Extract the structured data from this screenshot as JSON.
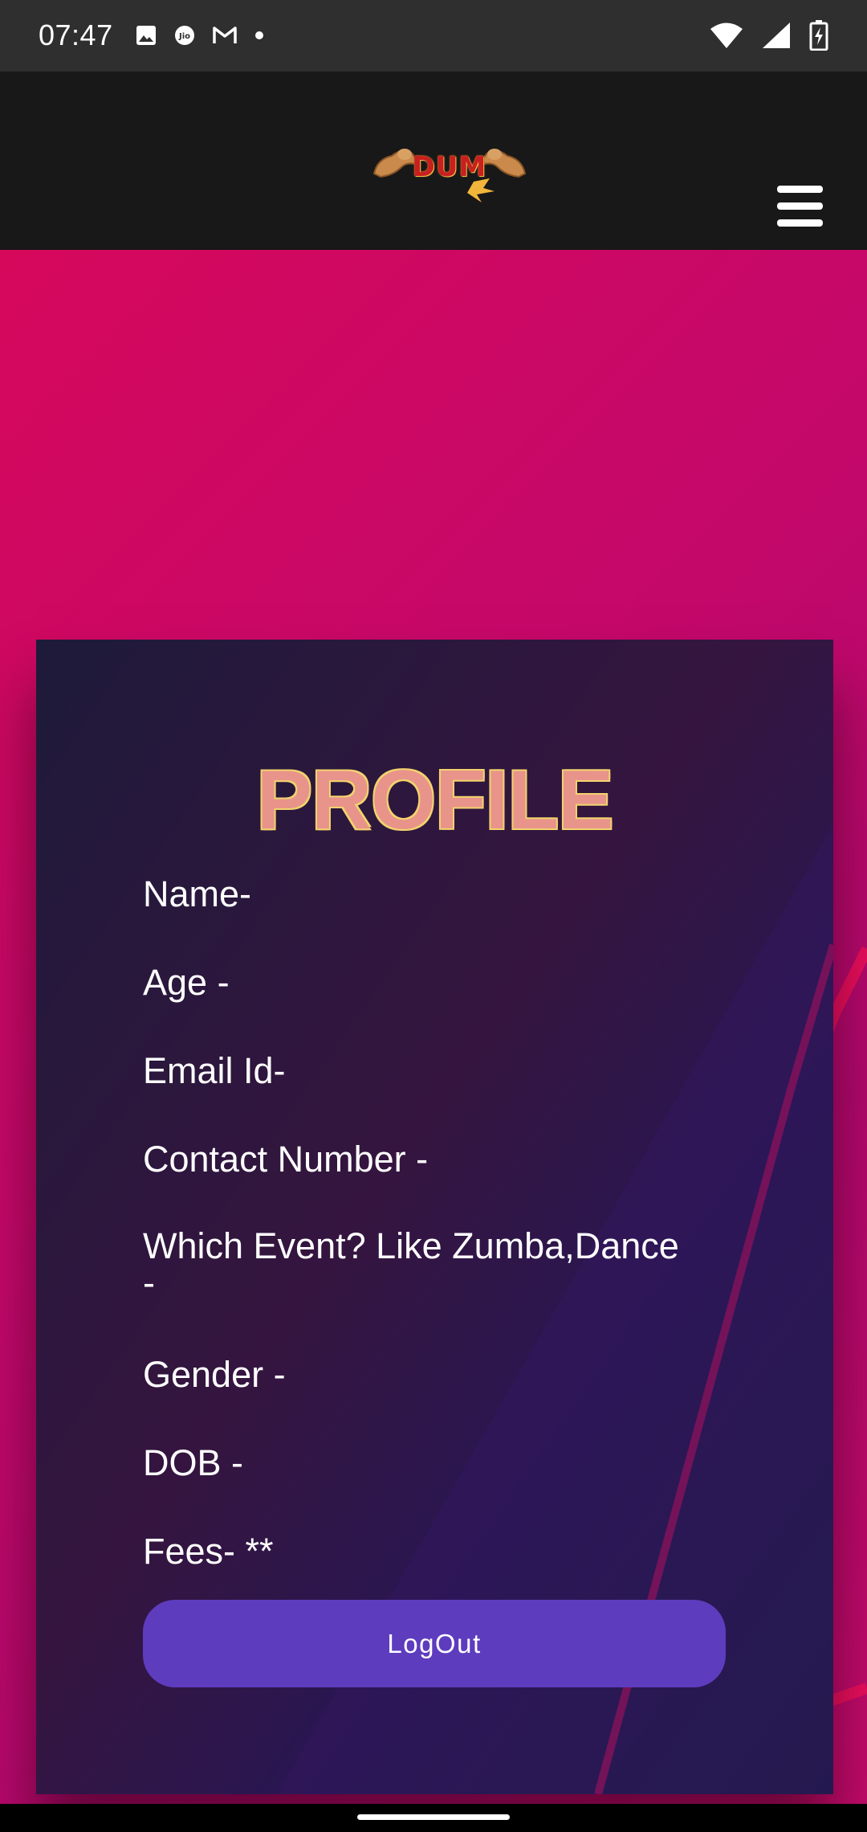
{
  "status_bar": {
    "time": "07:47",
    "left_icons": [
      "gallery-icon",
      "jio-icon",
      "gmail-icon",
      "dot-icon"
    ],
    "right_icons": [
      "wifi-icon",
      "signal-icon",
      "battery-charging-icon"
    ]
  },
  "header": {
    "logo_text": "DUM",
    "menu_icon": "hamburger-menu-icon"
  },
  "profile": {
    "title": "PROFILE",
    "fields": [
      "Name-",
      "Age -",
      "Email Id-",
      "Contact Number -",
      "Which Event? Like Zumba,Dance\n-",
      "Gender -",
      "DOB -",
      "Fees- **"
    ],
    "logout_label": "LogOut"
  },
  "colors": {
    "status_bar": "#2f2f2f",
    "header": "#181818",
    "background": "#c5086a",
    "card": "#2a1650",
    "title": "#e8948a",
    "button": "#5e3cbe"
  }
}
